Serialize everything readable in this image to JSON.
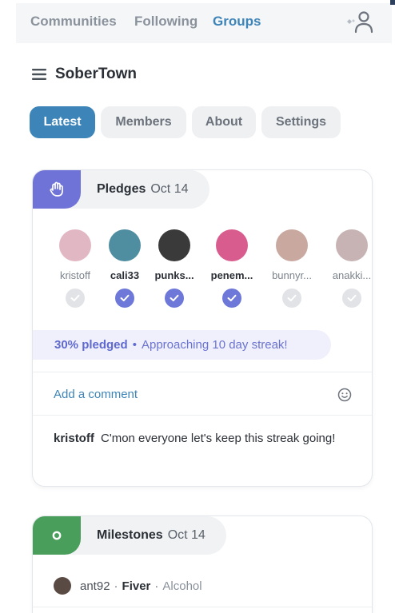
{
  "nav": {
    "links": [
      "Communities",
      "Following",
      "Groups"
    ],
    "active": "Groups",
    "profile_icon": "add-person-icon"
  },
  "group": {
    "title": "SoberTown",
    "menu_icon": "hamburger-icon"
  },
  "tabs": [
    {
      "label": "Latest",
      "active": true
    },
    {
      "label": "Members",
      "active": false
    },
    {
      "label": "About",
      "active": false
    },
    {
      "label": "Settings",
      "active": false
    }
  ],
  "pledges_card": {
    "badge_icon": "raised-hand-icon",
    "title": "Pledges",
    "date": "Oct 14",
    "accent": "#6f73d8",
    "members": [
      {
        "name": "kristoff",
        "pledged": false,
        "avatar_color": "#e2b7c4"
      },
      {
        "name": "cali33",
        "pledged": true,
        "avatar_color": "#4f8ea0"
      },
      {
        "name": "punks...",
        "pledged": true,
        "avatar_color": "#3a3a3a"
      },
      {
        "name": "penem...",
        "pledged": true,
        "avatar_color": "#d95c8f"
      },
      {
        "name": "bunnyr...",
        "pledged": false,
        "avatar_color": "#c9a8a0"
      },
      {
        "name": "anakki...",
        "pledged": false,
        "avatar_color": "#c7b3b3"
      }
    ],
    "progress_percent": "30% pledged",
    "progress_separator": "•",
    "progress_streak": "Approaching 10 day streak!",
    "comment_placeholder": "Add a comment",
    "emoji_icon": "smiley-icon",
    "comment": {
      "author": "kristoff",
      "text": "C'mon everyone let's keep this streak going!"
    }
  },
  "milestones_card": {
    "badge_icon": "ring-icon",
    "title": "Milestones",
    "date": "Oct 14",
    "accent": "#4a9e5c",
    "item": {
      "user": "ant92",
      "separator": "·",
      "milestone": "Fiver",
      "category": "Alcohol"
    }
  }
}
